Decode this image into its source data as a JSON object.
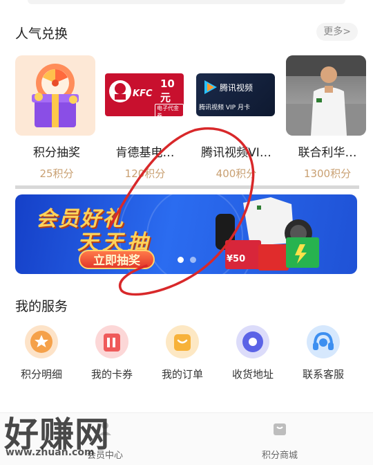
{
  "popular": {
    "title": "人气兑换",
    "more": "更多>",
    "items": [
      {
        "name": "积分抽奖",
        "points": "25积分"
      },
      {
        "name": "肯德基电…",
        "points": "120积分",
        "logo": "KFC",
        "value": "10元",
        "tag": "电子代金券"
      },
      {
        "name": "腾讯视频VI…",
        "points": "400积分",
        "logo": "腾讯视频",
        "card": "腾讯视频 VIP 月卡"
      },
      {
        "name": "联合利华…",
        "points": "1300积分"
      }
    ]
  },
  "banner": {
    "line1": "会员好礼",
    "line2": "天天抽",
    "cta": "立即抽奖",
    "card_value": "¥50"
  },
  "services": {
    "title": "我的服务",
    "items": [
      {
        "label": "积分明细",
        "icon": "star-icon",
        "color": "#f5a14a"
      },
      {
        "label": "我的卡券",
        "icon": "coupon-icon",
        "color": "#ef5a5a"
      },
      {
        "label": "我的订单",
        "icon": "order-bag-icon",
        "color": "#f7b23a"
      },
      {
        "label": "收货地址",
        "icon": "address-icon",
        "color": "#5b63e6"
      },
      {
        "label": "联系客服",
        "icon": "headset-icon",
        "color": "#3d8ff0"
      }
    ]
  },
  "tabbar": {
    "items": [
      {
        "label": "会员中心"
      },
      {
        "label": "积分商城"
      }
    ]
  },
  "watermark": {
    "brand": "好赚网",
    "url": "www.zhuan.com"
  }
}
